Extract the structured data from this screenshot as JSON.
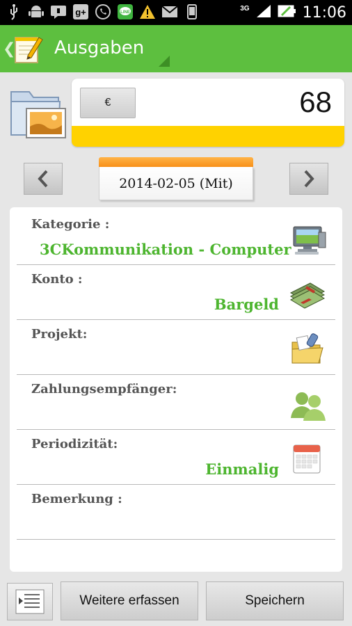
{
  "status_bar": {
    "time": "11:06",
    "network": "3G",
    "icons": [
      "usb-icon",
      "android-icon",
      "chat-icon",
      "google-plus-icon",
      "whatsapp-icon",
      "line-icon",
      "warning-icon",
      "gmail-icon",
      "phone-icon",
      "signal-icon",
      "battery-icon"
    ]
  },
  "action_bar": {
    "title": "Ausgaben",
    "back_glyph": "❮",
    "accent": "#5dbf3f"
  },
  "amount": {
    "currency": "€",
    "value": "68"
  },
  "date": {
    "prev_glyph": "‹",
    "next_glyph": "›",
    "value": "2014-02-05 (Mit)"
  },
  "form": {
    "rows": [
      {
        "label": "Kategorie :",
        "value": "3CKommunikation - Computer",
        "icon": "computer-icon"
      },
      {
        "label": "Konto :",
        "value": "Bargeld",
        "icon": "money-icon"
      },
      {
        "label": "Projekt:",
        "value": "",
        "icon": "project-folder-icon"
      },
      {
        "label": "Zahlungsempfänger:",
        "value": "",
        "icon": "people-icon"
      },
      {
        "label": "Periodizität:",
        "value": "Einmalig",
        "icon": "calendar-icon"
      },
      {
        "label": "Bemerkung :",
        "value": "",
        "icon": ""
      }
    ],
    "value_color": "#4db52f"
  },
  "bottom": {
    "more_label": "Weitere erfassen",
    "save_label": "Speichern"
  }
}
